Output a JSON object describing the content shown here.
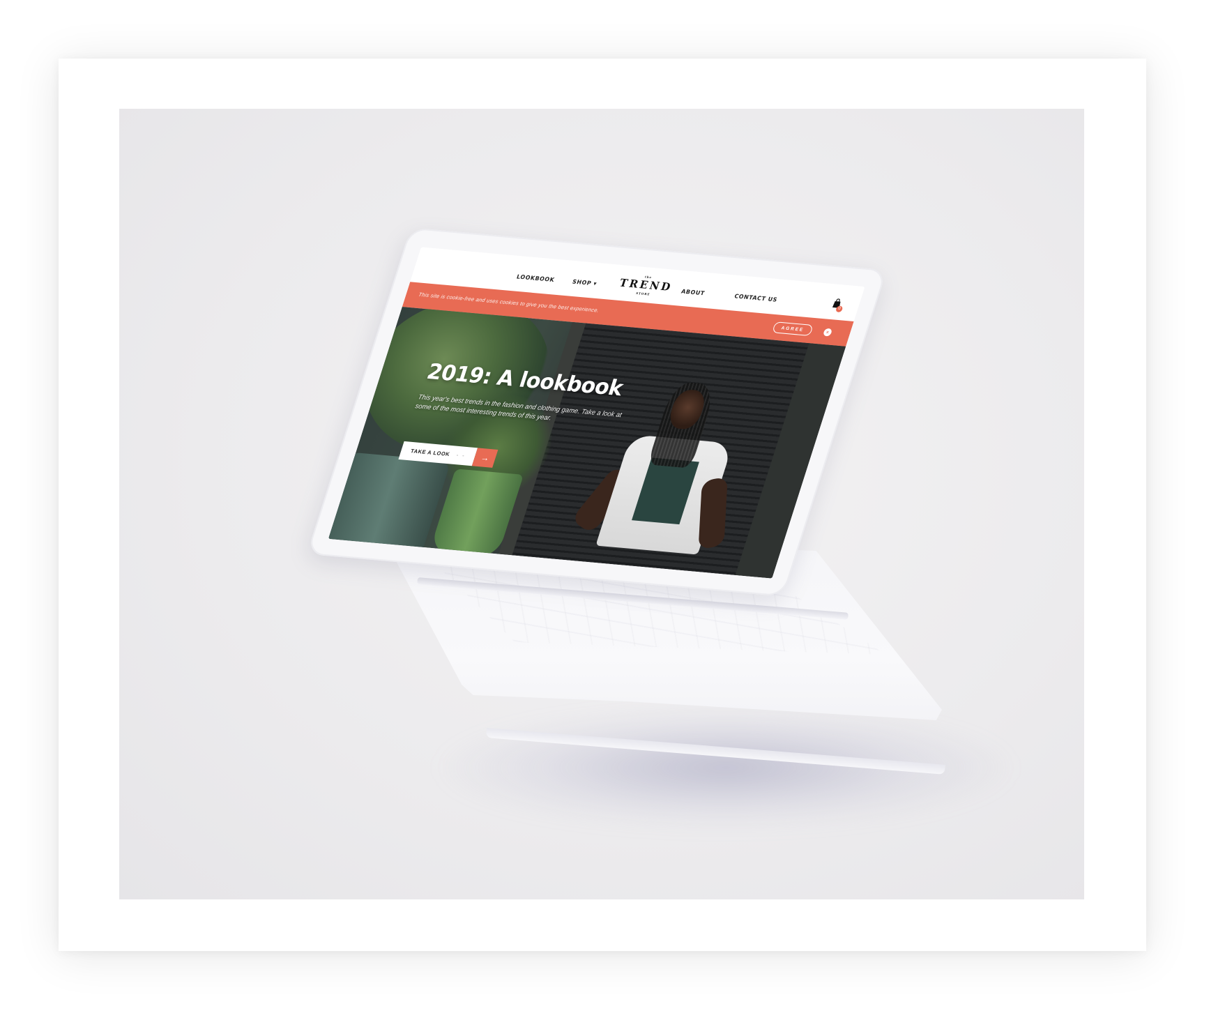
{
  "colors": {
    "accent": "#e86b54",
    "nav_text": "#222222",
    "hero_text": "#ffffff",
    "background": "#eceaed"
  },
  "nav": {
    "items": [
      "LOOKBOOK",
      "SHOP",
      "ABOUT",
      "CONTACT US"
    ],
    "shop_caret": "▾",
    "logo": "TREND",
    "logo_top": "the",
    "logo_sub": "STORE",
    "cart_icon": "shopping-bag-icon",
    "cart_count": "0"
  },
  "cookie": {
    "text": "This site is cookie-free and uses cookies to give you the best experience.",
    "agree_label": "AGREE",
    "close_glyph": "×"
  },
  "hero": {
    "title": "2019: A lookbook",
    "description": "This year's best trends in the fashion and clothing game. Take a look at some of the most interesting trends of this year.",
    "cta_label": "TAKE A LOOK",
    "cta_dash": "- -",
    "cta_arrow": "→"
  }
}
